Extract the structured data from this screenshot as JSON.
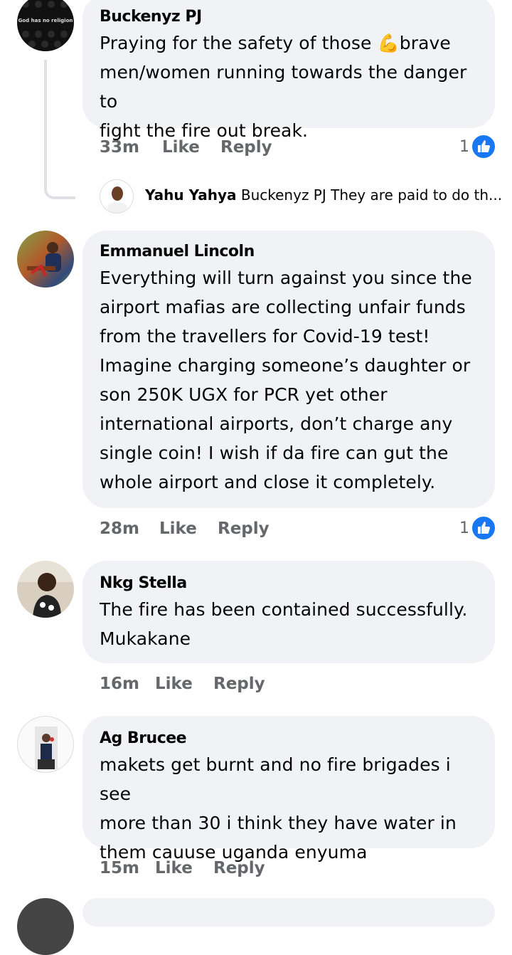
{
  "comments": [
    {
      "author": "Buckenyz PJ",
      "avatar_text": "God has no religion",
      "lines": [
        "Praying for the safety of those 💪brave",
        "men/women running towards the danger to",
        "fight the fire out break."
      ],
      "time": "33m",
      "like": "Like",
      "reply": "Reply",
      "reactions": "1",
      "reply_preview": {
        "author": "Yahu Yahya",
        "text": "Buckenyz PJ They are paid to do th..."
      }
    },
    {
      "author": "Emmanuel Lincoln",
      "lines": [
        "Everything will turn against you since the",
        "airport mafias are collecting unfair funds",
        "from the travellers for Covid-19 test!",
        "Imagine charging someone’s daughter or",
        "son 250K UGX for PCR yet other",
        "international airports, don’t charge any",
        "single coin! I wish if da fire can gut the",
        "whole airport and close it completely."
      ],
      "time": "28m",
      "like": "Like",
      "reply": "Reply",
      "reactions": "1"
    },
    {
      "author": "Nkg Stella",
      "lines": [
        "The fire has been contained successfully.",
        "Mukakane"
      ],
      "time": "16m",
      "like": "Like",
      "reply": "Reply"
    },
    {
      "author": "Ag Brucee",
      "lines": [
        "makets get burnt and no fire brigades  i see",
        "more than 30 i think they have water in",
        "them cauuse uganda enyuma"
      ],
      "time": "15m",
      "like": "Like",
      "reply": "Reply"
    }
  ],
  "colors": {
    "bubble": "#f0f2f5",
    "meta": "#65676b",
    "like_blue": "#1877f2"
  }
}
